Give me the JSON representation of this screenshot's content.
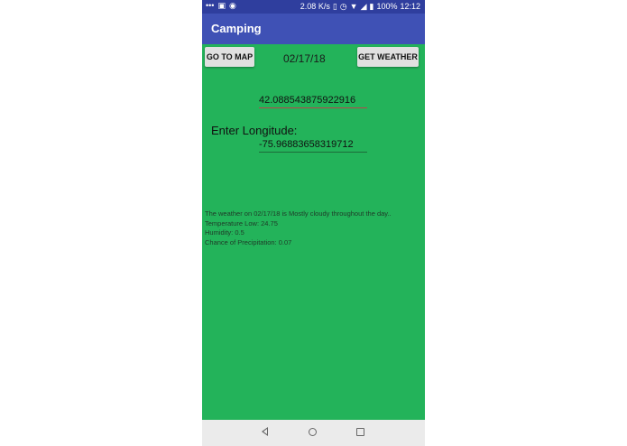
{
  "status_bar": {
    "speed": "2.08 K/s",
    "battery": "100%",
    "time": "12:12",
    "left_icons": [
      "dots-icon",
      "image-icon",
      "circle-icon"
    ],
    "right_icons": [
      "vibrate-icon",
      "alarm-icon",
      "wifi-icon",
      "signal-icon",
      "battery-icon"
    ]
  },
  "app_bar": {
    "title": "Camping"
  },
  "toolbar": {
    "map_button": "GO TO MAP",
    "date": "02/17/18",
    "weather_button": "GET WEATHER"
  },
  "form": {
    "latitude_value": "42.088543875922916",
    "longitude_label": "Enter Longitude:",
    "longitude_value": "-75.96883658319712"
  },
  "result": {
    "summary": "The weather on 02/17/18 is Mostly cloudy throughout the day..",
    "temperature_low": "Temperature Low: 24.75",
    "humidity": "Humidity: 0.5",
    "precipitation": "Chance of Precipitation: 0.07"
  },
  "colors": {
    "status_bar": "#2f3e9e",
    "app_bar": "#3f51b5",
    "background": "#23b35a",
    "button": "#e0e0e0",
    "lat_underline": "#b5484c"
  }
}
